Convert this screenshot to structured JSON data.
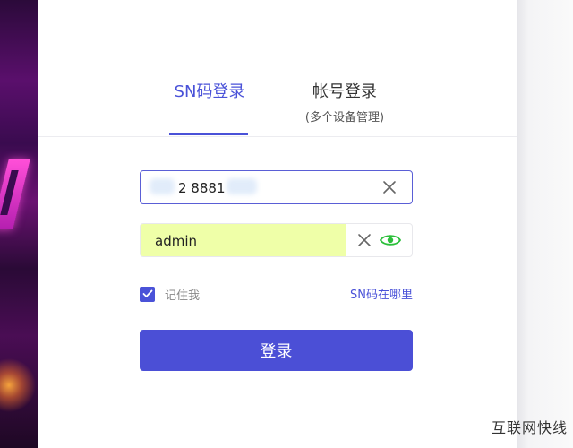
{
  "tabs": {
    "sn_login": "SN码登录",
    "account_login": "帐号登录",
    "account_login_sub": "(多个设备管理)"
  },
  "form": {
    "sn_value": "2 8881",
    "password_value": "admin",
    "remember_label": "记住我",
    "where_sn_link": "SN码在哪里",
    "login_button": "登录"
  },
  "watermark": "互联网快线",
  "colors": {
    "accent": "#4a52d8",
    "autofill": "#efffa8",
    "eye_icon": "#2bbf3a"
  },
  "icons": {
    "clear": "close-icon",
    "eye": "eye-icon",
    "checkbox": "checkmark-icon"
  }
}
